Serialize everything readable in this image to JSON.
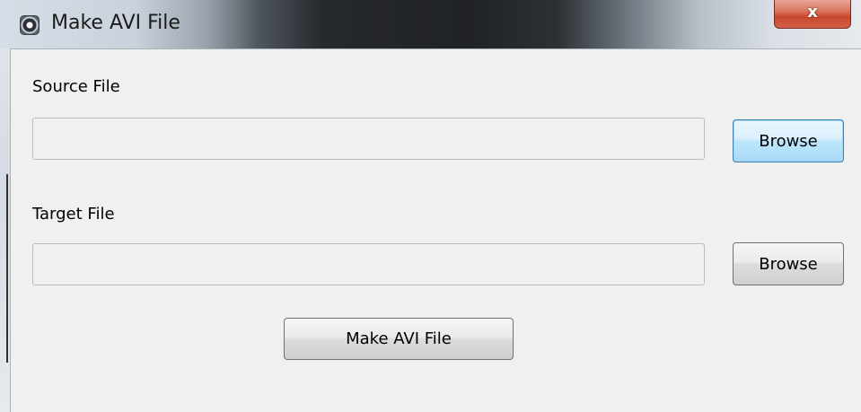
{
  "window": {
    "title": "Make AVI File",
    "close_label": "x"
  },
  "source": {
    "label": "Source File",
    "value": "",
    "browse_label": "Browse"
  },
  "target": {
    "label": "Target File",
    "value": "",
    "browse_label": "Browse"
  },
  "actions": {
    "make_label": "Make AVI File"
  },
  "colors": {
    "focus_border": "#3c7fb1",
    "close_button": "#c8462c",
    "client_background": "#f0f0f0"
  },
  "icons": {
    "app": "app-icon",
    "close": "close-icon"
  }
}
